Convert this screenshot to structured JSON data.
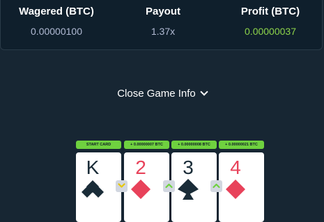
{
  "stats": {
    "wagered": {
      "label": "Wagered (BTC)",
      "value": "0.00000100"
    },
    "payout": {
      "label": "Payout",
      "value": "1.37x"
    },
    "profit": {
      "label": "Profit (BTC)",
      "value": "0.00000037"
    }
  },
  "info_toggle": {
    "label": "Close Game Info",
    "icon": "chevron-down-icon"
  },
  "cards": [
    {
      "badge": "START CARD",
      "rank": "K",
      "suit": "club",
      "color": "black"
    },
    {
      "badge": "+ 0.00000007 BTC",
      "rank": "2",
      "suit": "diamond",
      "color": "red"
    },
    {
      "badge": "+ 0.00000008 BTC",
      "rank": "3",
      "suit": "spade",
      "color": "black"
    },
    {
      "badge": "+ 0.00000021 BTC",
      "rank": "4",
      "suit": "diamond",
      "color": "red"
    }
  ],
  "guesses": [
    {
      "direction": "lower",
      "icon": "chevron-down-icon",
      "color": "#e6c600"
    },
    {
      "direction": "higher",
      "icon": "chevron-up-icon",
      "color": "#6fd13f"
    },
    {
      "direction": "higher",
      "icon": "chevron-up-icon",
      "color": "#6fd13f"
    }
  ],
  "colors": {
    "background": "#172633",
    "panel": "#0f1f2c",
    "profit": "#8dd34a",
    "badge": "#6fd13f",
    "card_red": "#e8425a",
    "card_black": "#1a2c38"
  }
}
